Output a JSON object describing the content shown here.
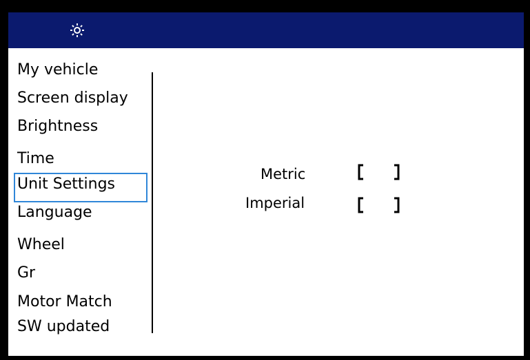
{
  "header": {
    "icon": "gear-icon",
    "background_color": "#0b1a6e"
  },
  "menu": {
    "items": [
      {
        "label": "My vehicle"
      },
      {
        "label": "Screen display"
      },
      {
        "label": "Brightness"
      },
      {
        "label": "Time"
      },
      {
        "label": "Unit Settings",
        "selected": true
      },
      {
        "label": "Language"
      },
      {
        "label": "Wheel"
      },
      {
        "label": "Gr"
      },
      {
        "label": "Motor Match"
      },
      {
        "label": "SW updated"
      }
    ],
    "selection_color": "#2f86d8"
  },
  "unit_options": [
    {
      "label": "Metric",
      "checked": false
    },
    {
      "label": "Imperial",
      "checked": false
    }
  ]
}
